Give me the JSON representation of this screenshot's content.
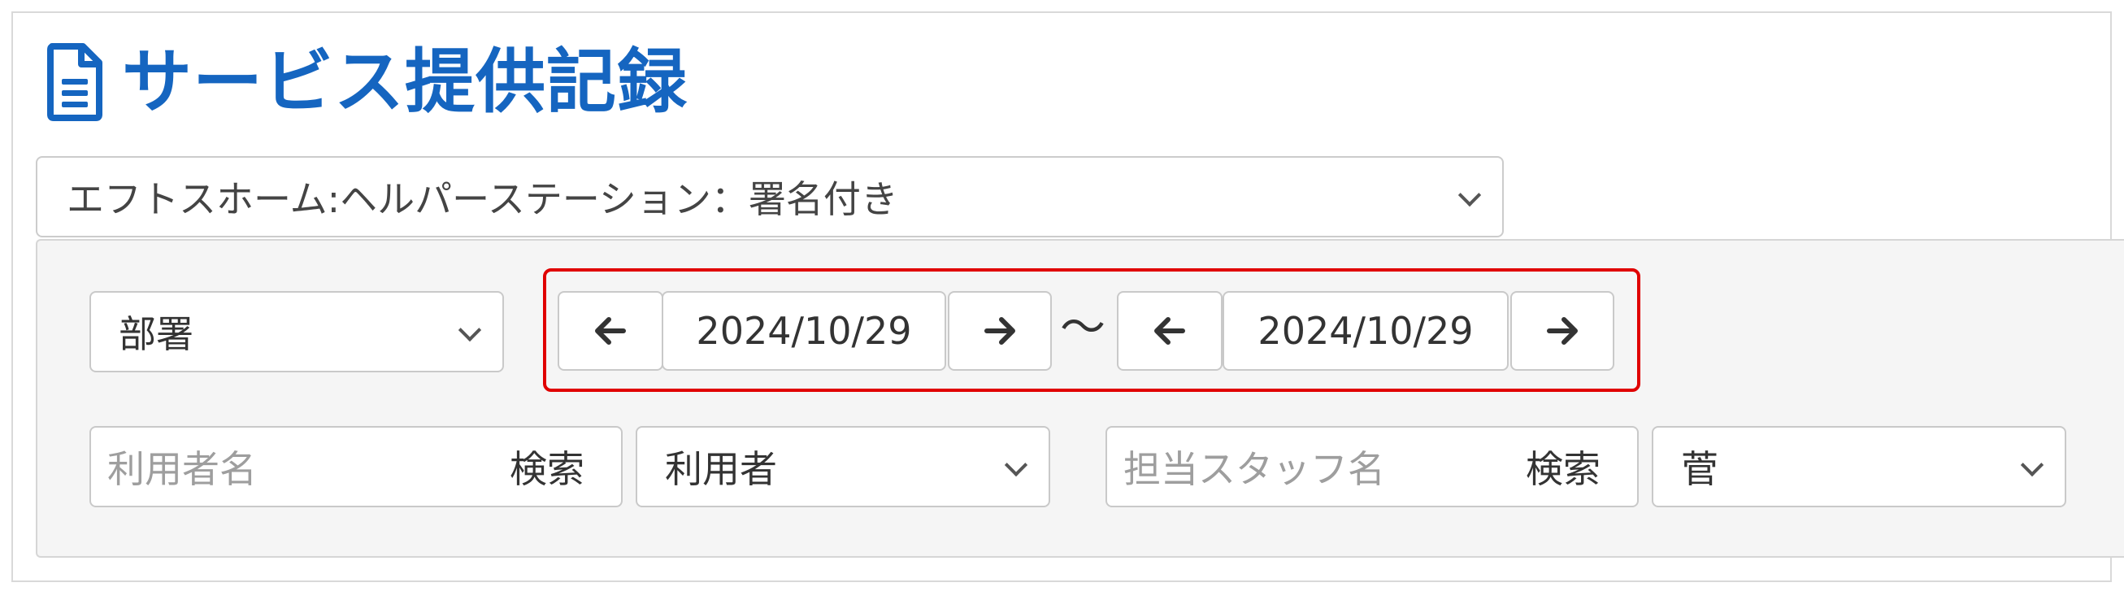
{
  "page": {
    "title": "サービス提供記録",
    "title_icon": "document-icon",
    "accent_color": "#1565c0"
  },
  "office_select": {
    "value": "エフトスホーム:ヘルパーステーション：署名付き"
  },
  "filters": {
    "department_select": {
      "value": "部署"
    },
    "date_range": {
      "start_date": "2024/10/29",
      "end_date": "2024/10/29",
      "separator": "～",
      "highlight_color": "#e00000"
    },
    "user_search": {
      "placeholder": "利用者名",
      "button_label": "検索",
      "select_value": "利用者"
    },
    "staff_search": {
      "placeholder": "担当スタッフ名",
      "button_label": "検索",
      "select_value": "菅"
    }
  }
}
